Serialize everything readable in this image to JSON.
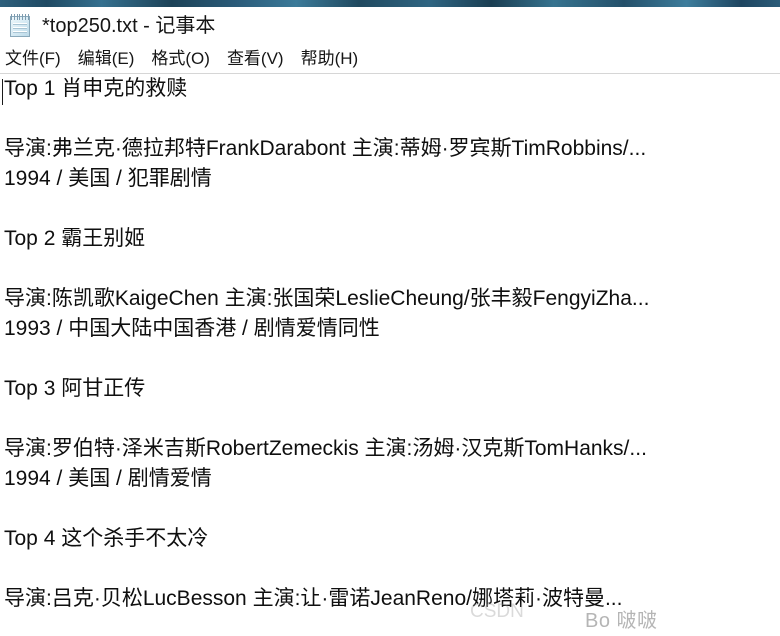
{
  "window": {
    "icon": "notepad-icon",
    "title": "*top250.txt - 记事本"
  },
  "menu": {
    "items": [
      {
        "label": "文件(F)"
      },
      {
        "label": "编辑(E)"
      },
      {
        "label": "格式(O)"
      },
      {
        "label": "查看(V)"
      },
      {
        "label": "帮助(H)"
      }
    ]
  },
  "document": {
    "lines": [
      "Top 1 肖申克的救赎",
      "",
      "导演:弗兰克·德拉邦特FrankDarabont    主演:蒂姆·罗宾斯TimRobbins/...",
      "1994 / 美国 / 犯罪剧情",
      "",
      "Top 2 霸王别姬",
      "",
      "导演:陈凯歌KaigeChen    主演:张国荣LeslieCheung/张丰毅FengyiZha...",
      "1993 / 中国大陆中国香港 / 剧情爱情同性",
      "",
      "Top 3 阿甘正传",
      "",
      "导演:罗伯特·泽米吉斯RobertZemeckis    主演:汤姆·汉克斯TomHanks/...",
      "1994 / 美国 / 剧情爱情",
      "",
      "Top 4 这个杀手不太冷",
      "",
      "导演:吕克·贝松LucBesson    主演:让·雷诺JeanReno/娜塔莉·波特曼..."
    ]
  },
  "watermark": {
    "text": "Bo 啵啵",
    "faint_text": "CSDN"
  },
  "colors": {
    "text": "#0f0f0f",
    "chrome_strip": "#2b5c79",
    "separator": "#d6d6d6",
    "background": "#ffffff"
  }
}
